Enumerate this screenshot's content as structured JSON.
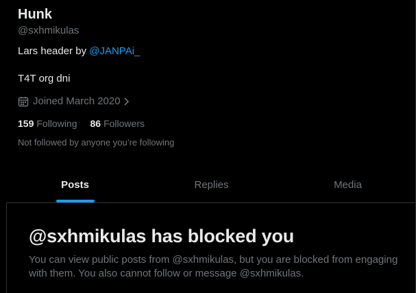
{
  "profile": {
    "display_name": "Hunk",
    "handle": "@sxhmikulas",
    "bio_prefix": "Lars header by ",
    "bio_link": "@JANPAi_",
    "bio_line2": "T4T org dni",
    "joined": "Joined March 2020",
    "joined_icon": "calendar-icon",
    "following_count": "159",
    "following_label": "Following",
    "followers_count": "86",
    "followers_label": "Followers",
    "not_followed_text": "Not followed by anyone you’re following"
  },
  "tabs": [
    {
      "label": "Posts",
      "active": true
    },
    {
      "label": "Replies",
      "active": false
    },
    {
      "label": "Media",
      "active": false
    }
  ],
  "blocked": {
    "title": "@sxhmikulas has blocked you",
    "body": "You can view public posts from @sxhmikulas, but you are blocked from engaging with them. You also cannot follow or message @sxhmikulas."
  },
  "colors": {
    "background": "#000000",
    "text_primary": "#e7e9ea",
    "text_secondary": "#71767b",
    "accent": "#1d9bf0",
    "border": "#2f3336"
  }
}
